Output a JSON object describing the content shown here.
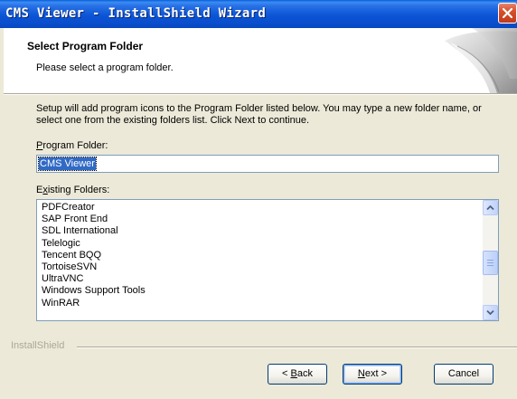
{
  "window": {
    "title": "CMS Viewer - InstallShield Wizard"
  },
  "header": {
    "title": "Select Program Folder",
    "subtitle": "Please select a program folder."
  },
  "body": {
    "description": "Setup will add program icons to the Program Folder listed below.  You may type a new folder name, or select one from the existing folders list.  Click Next to continue.",
    "program_folder_label_accel": "P",
    "program_folder_label_rest": "rogram Folder:",
    "program_folder_value": "CMS Viewer",
    "existing_folders_label_pre": "E",
    "existing_folders_label_accel": "x",
    "existing_folders_label_rest": "isting Folders:",
    "existing_folders": [
      "PDFCreator",
      "SAP Front End",
      "SDL International",
      "Telelogic",
      "Tencent BQQ",
      "TortoiseSVN",
      "UltraVNC",
      "Windows Support Tools",
      "WinRAR"
    ]
  },
  "footer": {
    "brand": "InstallShield",
    "back_arrow": "<",
    "back_accel": "B",
    "back_rest": "ack",
    "next_accel": "N",
    "next_rest": "ext",
    "next_arrow": ">",
    "cancel_label": "Cancel"
  },
  "colors": {
    "titlebar": "#0a54d6",
    "selection": "#316ac5",
    "dialog_bg": "#ece9d8"
  }
}
